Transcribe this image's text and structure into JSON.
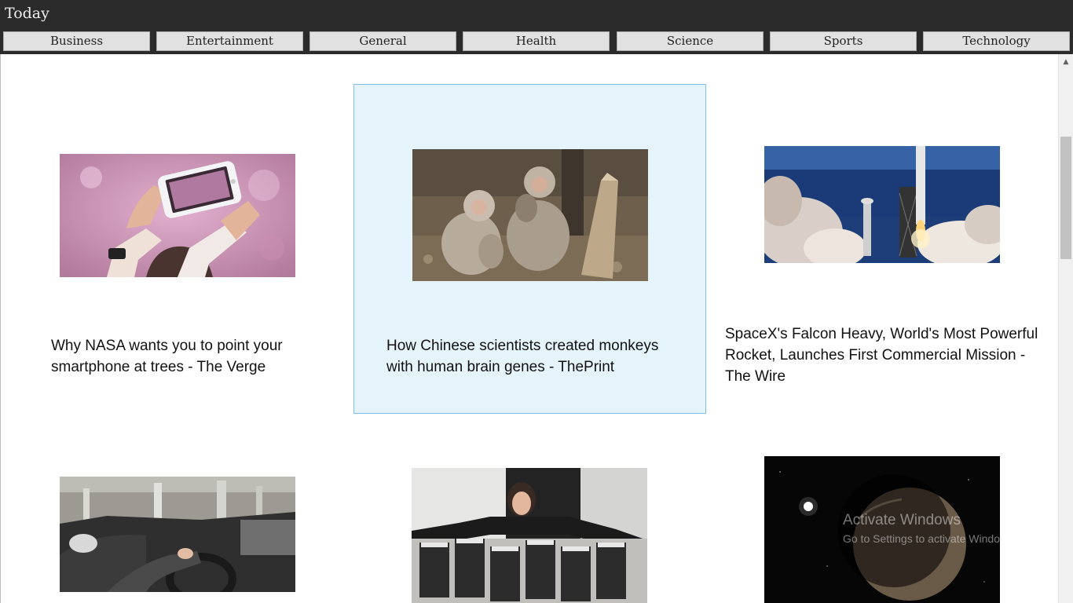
{
  "window": {
    "title": "Today"
  },
  "categories": [
    {
      "label": "Business"
    },
    {
      "label": "Entertainment"
    },
    {
      "label": "General"
    },
    {
      "label": "Health"
    },
    {
      "label": "Science"
    },
    {
      "label": "Sports"
    },
    {
      "label": "Technology"
    }
  ],
  "articles": [
    {
      "headline": "Why NASA wants you to point your smartphone at trees - The Verge",
      "image": "hands holding smartphone photographing cherry blossoms"
    },
    {
      "headline": "How Chinese scientists created monkeys with human brain genes - ThePrint",
      "image": "macaque monkeys sitting by a tree stump"
    },
    {
      "headline": "SpaceX's Falcon Heavy, World's Most Powerful Rocket, Launches First Commercial Mission - The Wire",
      "image": "rocket launching from a pad by the sea"
    },
    {
      "headline": "",
      "image": "driver's view from a car over a city"
    },
    {
      "headline": "",
      "image": "woman with arms spread over stacks of hard drives"
    },
    {
      "headline": "",
      "image": "planet and star in dark space"
    }
  ],
  "watermark": {
    "line1": "Activate Windows",
    "line2": "Go to Settings to activate Windows."
  },
  "colors": {
    "titlebar": "#2b2b2b",
    "selected_bg": "#e5f3fb",
    "selected_border": "#7ebfe8"
  }
}
